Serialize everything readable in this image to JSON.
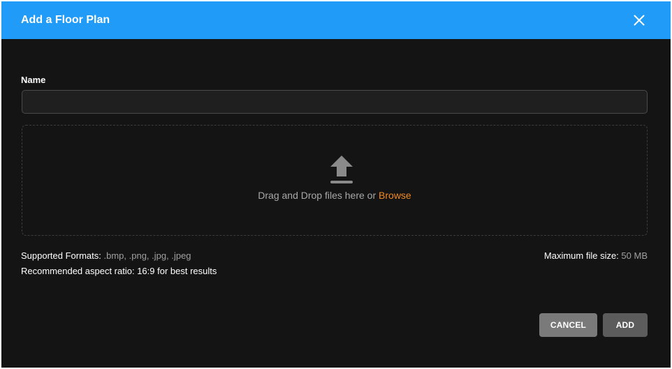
{
  "dialog": {
    "title": "Add a Floor Plan",
    "close_icon": "close-icon"
  },
  "form": {
    "name_label": "Name",
    "name_value": "",
    "name_placeholder": ""
  },
  "dropzone": {
    "icon": "upload-icon",
    "text": "Drag and Drop files here or ",
    "browse_label": "Browse"
  },
  "info": {
    "formats_label": "Supported Formats: ",
    "formats_value": ".bmp, .png, .jpg, .jpeg",
    "aspect_text": "Recommended aspect ratio: 16:9 for best results",
    "maxsize_label": "Maximum file size: ",
    "maxsize_value": "50 MB"
  },
  "actions": {
    "cancel_label": "CANCEL",
    "add_label": "ADD"
  },
  "colors": {
    "header": "#209bf7",
    "background": "#141414",
    "browse_link": "#f08a24"
  }
}
